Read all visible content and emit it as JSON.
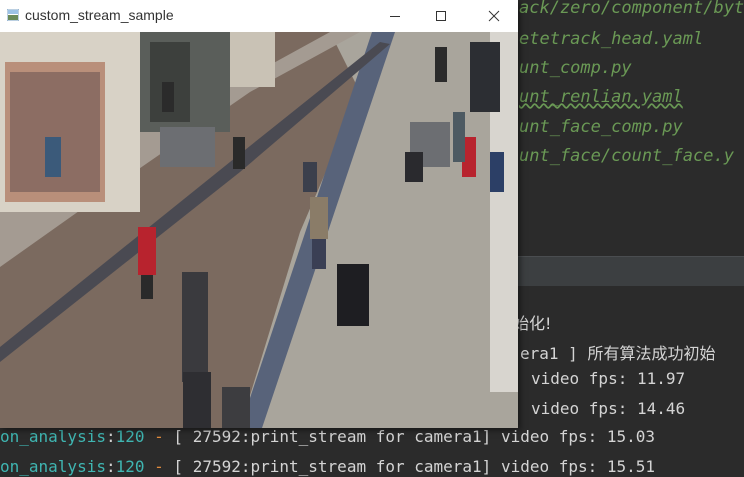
{
  "window": {
    "title": "custom_stream_sample",
    "icon": "opencv-window-icon",
    "minimize_icon": "minimize-icon",
    "maximize_icon": "maximize-icon",
    "close_icon": "close-icon"
  },
  "editor": {
    "lines": [
      "ack/zero/component/byt",
      "etetrack_head.yaml",
      "unt_comp.py",
      "unt_renlian.yaml",
      "unt_face_comp.py",
      "unt_face/count_face.y"
    ]
  },
  "console": {
    "right_lines": [
      {
        "text": "始化!"
      },
      {
        "prefix": "era1 ] ",
        "text": "所有算法成功初始"
      },
      {
        "text": "video fps: 11.97"
      },
      {
        "text": "video fps: 14.46"
      }
    ],
    "full_lines": [
      {
        "module": "on_analysis",
        "line_no": "120",
        "sep": " - ",
        "body": "[ 27592:print_stream for camera1] video fps: 15.03"
      },
      {
        "module": "on_analysis",
        "line_no": "120",
        "sep": " - ",
        "body": "[ 27592:print_stream for camera1] video fps: 15.51"
      }
    ]
  },
  "colors": {
    "console_bg": "#2b2b2b",
    "yaml_text": "#6a9955",
    "module_teal": "#3fb6b2",
    "separator_orange": "#e08a3c"
  }
}
